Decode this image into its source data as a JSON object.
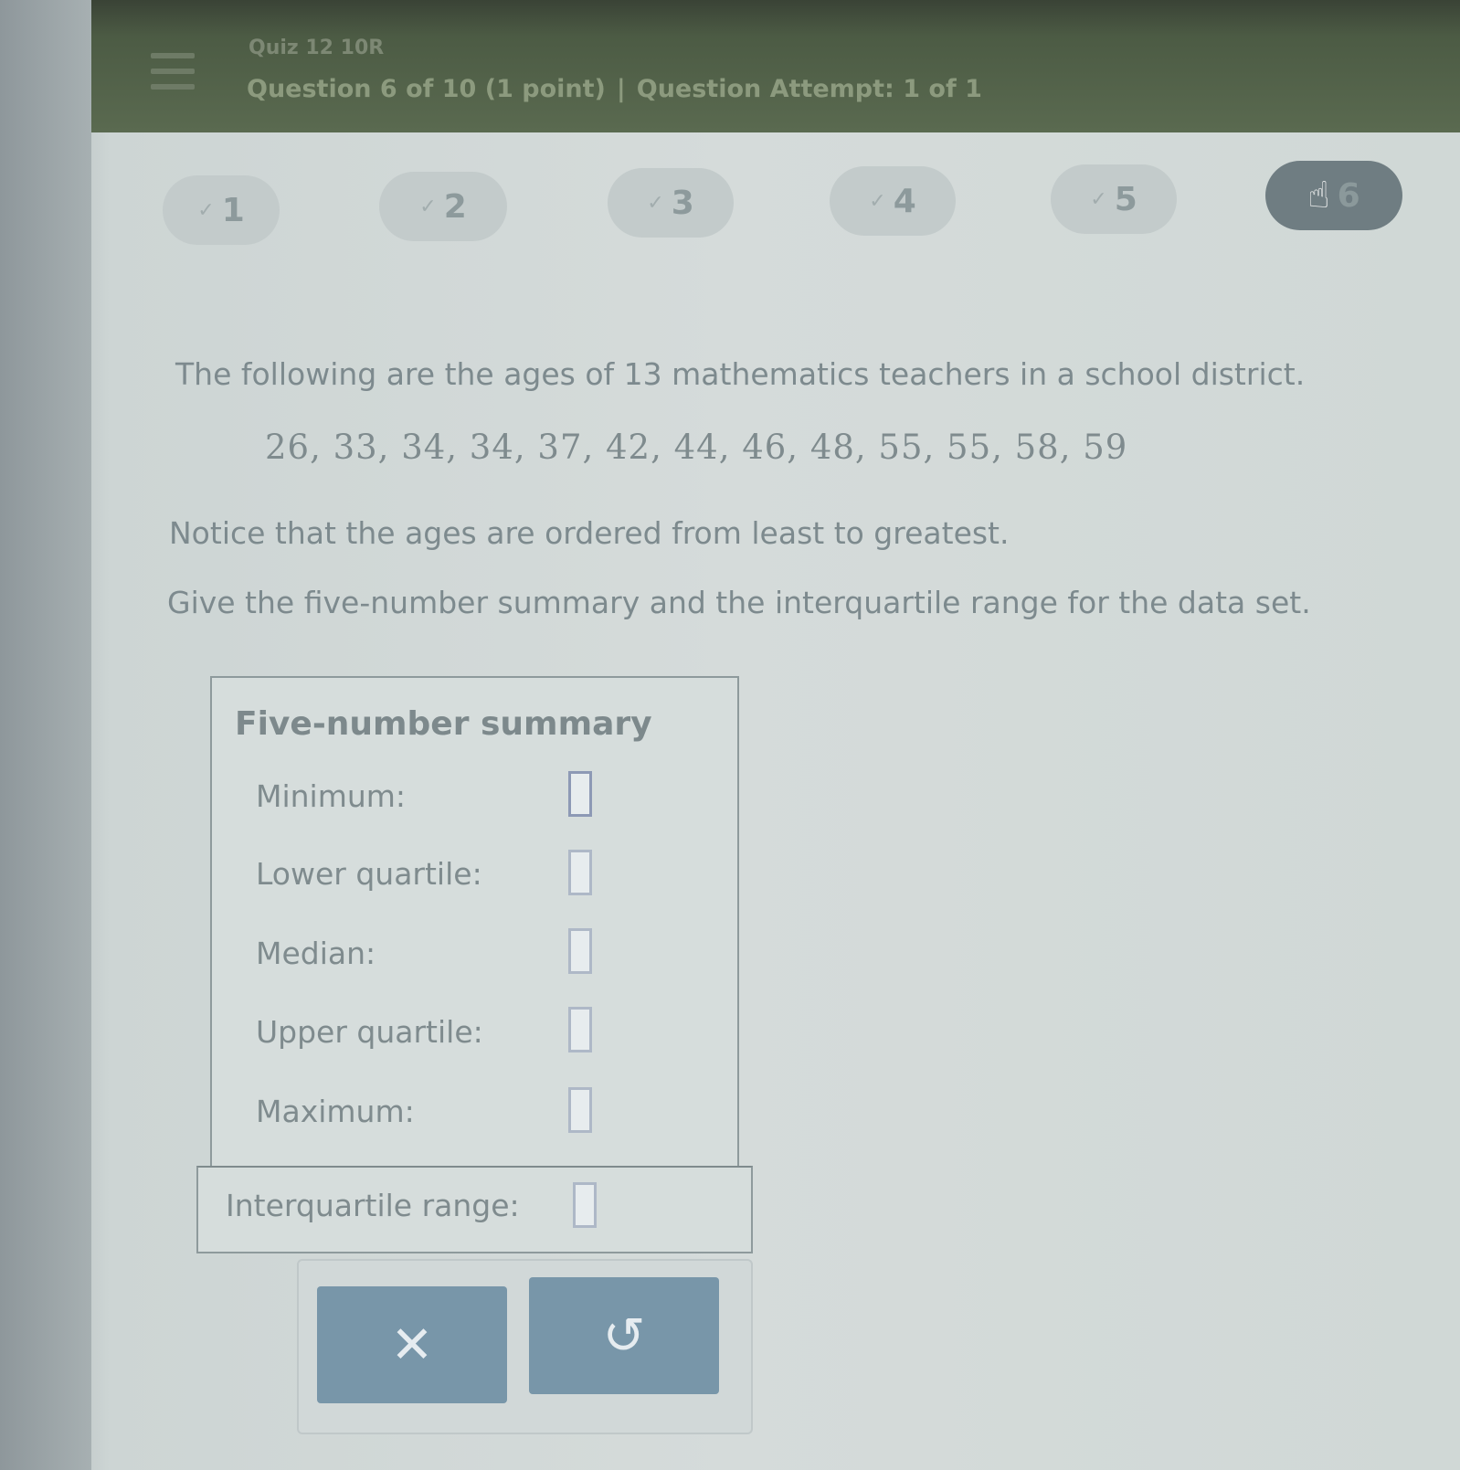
{
  "header": {
    "quiz_title": "Quiz 12 10R",
    "question_position": "Question 6 of 10 (1 point)",
    "separator": "|",
    "attempt": "Question Attempt: 1 of 1"
  },
  "question_nav": [
    {
      "label": "1",
      "state": "answered"
    },
    {
      "label": "2",
      "state": "answered"
    },
    {
      "label": "3",
      "state": "answered"
    },
    {
      "label": "4",
      "state": "answered"
    },
    {
      "label": "5",
      "state": "answered"
    },
    {
      "label": "6",
      "state": "current"
    }
  ],
  "nav_marker": "✓",
  "problem": {
    "intro": "The following are the ages of 13 mathematics teachers in a school district.",
    "data": "26,  33,  34,  34,  37,  42,  44,  46,  48,  55,  55,  58,  59",
    "notice": "Notice that the ages are ordered from least to greatest.",
    "instruction": "Give the five-number summary and the interquartile range for the data set."
  },
  "summary": {
    "heading": "Five-number summary",
    "rows": [
      {
        "label": "Minimum:",
        "value": ""
      },
      {
        "label": "Lower quartile:",
        "value": ""
      },
      {
        "label": "Median:",
        "value": ""
      },
      {
        "label": "Upper quartile:",
        "value": ""
      },
      {
        "label": "Maximum:",
        "value": ""
      }
    ],
    "iqr_label": "Interquartile range:",
    "iqr_value": ""
  },
  "actions": {
    "clear_symbol": "✕",
    "undo_symbol": "↺"
  },
  "colors": {
    "topbar": "#4c5b44",
    "button": "#7896a9",
    "input_border": "#aeb8c7"
  }
}
